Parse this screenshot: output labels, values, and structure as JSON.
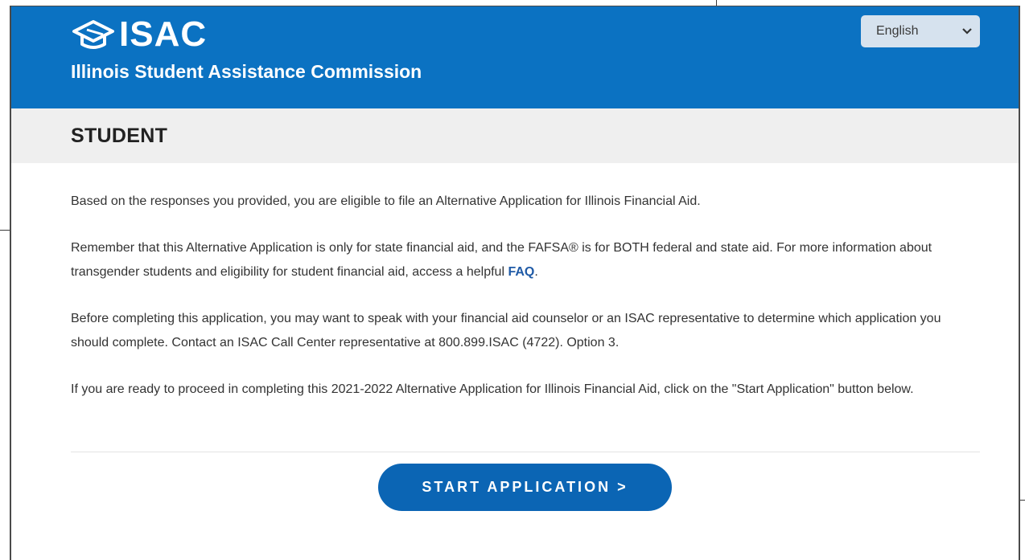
{
  "header": {
    "logo_text": "ISAC",
    "org_name": "Illinois Student Assistance Commission",
    "language_select": {
      "selected": "English"
    }
  },
  "page": {
    "title": "STUDENT"
  },
  "content": {
    "p1": "Based on the responses you provided, you are eligible to file an Alternative Application for Illinois Financial Aid.",
    "p2_text": "Remember that this Alternative Application is only for state financial aid, and the FAFSA® is for BOTH federal and state aid. For more information about transgender students and eligibility for student financial aid, access a helpful ",
    "p2_link": "FAQ",
    "p2_end": ".",
    "p3": "Before completing this application, you may want to speak with your financial aid counselor or an ISAC representative to determine which application you should complete. Contact an ISAC Call Center representative at 800.899.ISAC (4722). Option 3.",
    "p4": "If you are ready to proceed in completing this 2021-2022 Alternative Application for Illinois Financial Aid, click on the \"Start Application\" button below."
  },
  "actions": {
    "start_label": "START APPLICATION >"
  },
  "colors": {
    "brand_blue": "#0b72c2",
    "button_blue": "#0b65b4",
    "link_blue": "#1f5aa6"
  },
  "icons": {
    "logo": "graduation-cap-icon",
    "dropdown": "chevron-down-icon"
  }
}
